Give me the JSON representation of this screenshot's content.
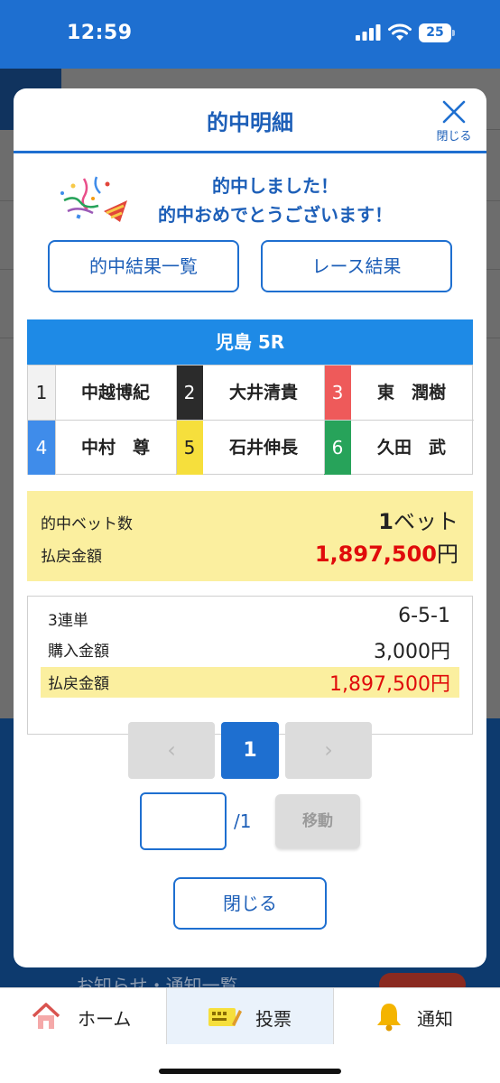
{
  "status": {
    "time": "12:59",
    "battery": "25"
  },
  "background": {
    "notice": "お知らせ・通知一覧"
  },
  "modal": {
    "title": "的中明細",
    "close_label": "閉じる",
    "congrats_line1": "的中しました！",
    "congrats_line2": "的中おめでとうございます！",
    "btn_hit_list": "的中結果一覧",
    "btn_race_result": "レース結果",
    "race": "児島 5R",
    "entries": [
      {
        "num": "1",
        "name": "中越博紀",
        "bg": "#f2f2f2",
        "fg": "#222222"
      },
      {
        "num": "2",
        "name": "大井清貴",
        "bg": "#2b2b2b",
        "fg": "#ffffff"
      },
      {
        "num": "3",
        "name": "東　潤樹",
        "bg": "#ee5a5a",
        "fg": "#ffffff"
      },
      {
        "num": "4",
        "name": "中村　尊",
        "bg": "#3f8cea",
        "fg": "#ffffff"
      },
      {
        "num": "5",
        "name": "石井伸長",
        "bg": "#f6df3c",
        "fg": "#222222"
      },
      {
        "num": "6",
        "name": "久田　武",
        "bg": "#27a35a",
        "fg": "#ffffff"
      }
    ],
    "summary": {
      "bet_count_label": "的中ベット数",
      "bet_count": "1",
      "bet_unit": "ベット",
      "payout_label": "払戻金額",
      "payout": "1,897,500",
      "yen": "円"
    },
    "detail": {
      "type_label": "3連単",
      "combination": "6-5-1",
      "purchase_label": "購入金額",
      "purchase": "3,000円",
      "payout_label": "払戻金額",
      "payout": "1,897,500円"
    },
    "pager": {
      "prev": "‹",
      "current": "1",
      "next": "›",
      "total": "/1",
      "jump_label": "移動"
    },
    "close_button": "閉じる"
  },
  "tabbar": {
    "home": "ホーム",
    "vote": "投票",
    "notify": "通知"
  },
  "colors": {
    "accent": "#1e6fd0",
    "highlight": "#fbef9f",
    "payout_red": "#e00b0b"
  }
}
